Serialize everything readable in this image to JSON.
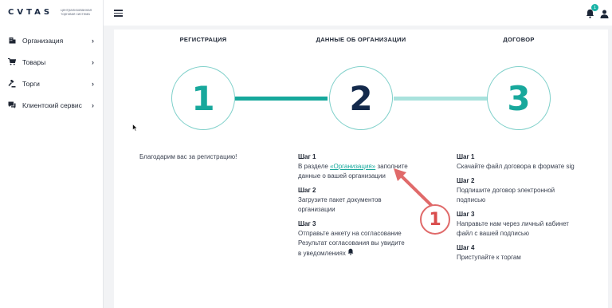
{
  "logo": {
    "text": "CVTAS",
    "subtitle": "централизованная торговая система"
  },
  "sidebar": {
    "items": [
      {
        "label": "Организация",
        "icon": "building-icon"
      },
      {
        "label": "Товары",
        "icon": "cart-icon"
      },
      {
        "label": "Торги",
        "icon": "gavel-icon"
      },
      {
        "label": "Клиентский сервис",
        "icon": "chat-icon"
      }
    ]
  },
  "topbar": {
    "notifications_count": "1"
  },
  "steps": {
    "titles": [
      "РЕГИСТРАЦИЯ",
      "ДАННЫЕ ОБ ОРГАНИЗАЦИИ",
      "ДОГОВОР"
    ],
    "numbers": [
      "1",
      "2",
      "3"
    ]
  },
  "col1": {
    "text": "Благодарим вас за регистрацию!"
  },
  "col2": {
    "s1_h": "Шаг 1",
    "s1_pre": "В разделе ",
    "s1_link": "«Организация»",
    "s1_post": "заполните данные о вашей организации",
    "s2_h": "Шаг 2",
    "s2_t": "Загрузите пакет документов организации",
    "s3_h": "Шаг 3",
    "s3_t": "Отправьте анкету на согласование",
    "s3_t2": "Результат согласования вы увидите в уведомлениях"
  },
  "col3": {
    "s1_h": "Шаг 1",
    "s1_t": "Скачайте файл договора в формате sig",
    "s2_h": "Шаг 2",
    "s2_t": "Подпишите договор электронной подписью",
    "s3_h": "Шаг 3",
    "s3_t": "Направьте нам через личный кабинет файл с вашей подписью",
    "s4_h": "Шаг 4",
    "s4_t": "Приступайте к торгам"
  },
  "annotation": {
    "number": "1"
  },
  "colors": {
    "accent": "#16a89c",
    "accent_light": "#a9e2dd",
    "dark": "#13294b",
    "annotation": "#e06a6a"
  }
}
